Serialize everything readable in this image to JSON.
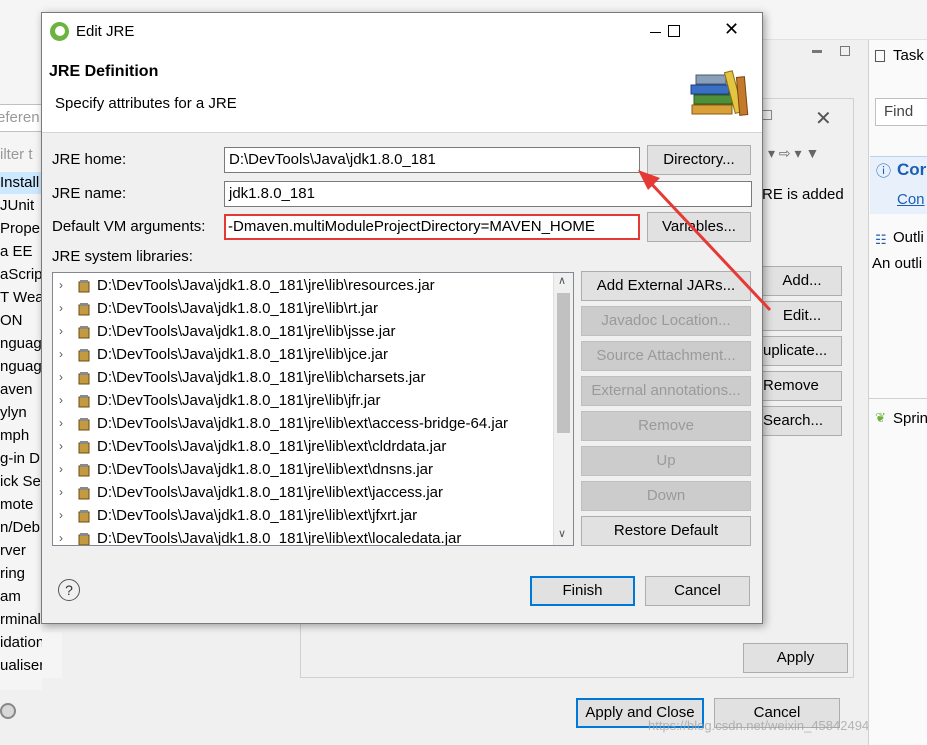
{
  "background": {
    "left_items": [
      "eferen",
      "ilter t",
      "Install",
      "JUnit",
      "Prope",
      "a EE",
      "aScrip",
      "T Wea",
      "ON",
      "nguag",
      "nguag",
      "aven",
      "ylyn",
      "mph",
      "g-in D",
      "ick Se",
      "mote",
      "n/Deb",
      "rver",
      "ring",
      "am",
      "rminal",
      "idation",
      "ualiser"
    ],
    "right_panel": {
      "task_label": "Task",
      "find_placeholder": "Find",
      "connect_title": "Cor",
      "connect_link": "Con",
      "outline_label": "Outli",
      "outline_text": "An outli",
      "spring_label": "Sprin"
    },
    "prefs_panel": {
      "jre_added_text": "RE is added",
      "add_button": "Add...",
      "edit_button": "Edit...",
      "duplicate_button": "uplicate...",
      "remove_button": "Remove",
      "search_button": "Search...",
      "apply_button": "Apply",
      "apply_close_button": "Apply and Close",
      "cancel_button": "Cancel"
    },
    "watermark": "https://blog.csdn.net/weixin_45842494"
  },
  "dialog": {
    "title": "Edit JRE",
    "header_title": "JRE Definition",
    "header_subtitle": "Specify attributes for a JRE",
    "jre_home_label": "JRE home:",
    "jre_home_value": "D:\\DevTools\\Java\\jdk1.8.0_181",
    "directory_button": "Directory...",
    "jre_name_label": "JRE name:",
    "jre_name_value": "jdk1.8.0_181",
    "vm_args_label": "Default VM arguments:",
    "vm_args_value": "-Dmaven.multiModuleProjectDirectory=MAVEN_HOME",
    "variables_button": "Variables...",
    "libraries_label": "JRE system libraries:",
    "libraries": [
      "D:\\DevTools\\Java\\jdk1.8.0_181\\jre\\lib\\resources.jar",
      "D:\\DevTools\\Java\\jdk1.8.0_181\\jre\\lib\\rt.jar",
      "D:\\DevTools\\Java\\jdk1.8.0_181\\jre\\lib\\jsse.jar",
      "D:\\DevTools\\Java\\jdk1.8.0_181\\jre\\lib\\jce.jar",
      "D:\\DevTools\\Java\\jdk1.8.0_181\\jre\\lib\\charsets.jar",
      "D:\\DevTools\\Java\\jdk1.8.0_181\\jre\\lib\\jfr.jar",
      "D:\\DevTools\\Java\\jdk1.8.0_181\\jre\\lib\\ext\\access-bridge-64.jar",
      "D:\\DevTools\\Java\\jdk1.8.0_181\\jre\\lib\\ext\\cldrdata.jar",
      "D:\\DevTools\\Java\\jdk1.8.0_181\\jre\\lib\\ext\\dnsns.jar",
      "D:\\DevTools\\Java\\jdk1.8.0_181\\jre\\lib\\ext\\jaccess.jar",
      "D:\\DevTools\\Java\\jdk1.8.0_181\\jre\\lib\\ext\\jfxrt.jar",
      "D:\\DevTools\\Java\\jdk1.8.0_181\\jre\\lib\\ext\\localedata.jar"
    ],
    "side_buttons": {
      "add_external_jars": "Add External JARs...",
      "javadoc_location": "Javadoc Location...",
      "source_attachment": "Source Attachment...",
      "external_annotations": "External annotations...",
      "remove": "Remove",
      "up": "Up",
      "down": "Down",
      "restore_default": "Restore Default"
    },
    "finish_button": "Finish",
    "cancel_button": "Cancel"
  },
  "colors": {
    "highlight_red": "#e53935",
    "default_button_blue": "#0078d7"
  }
}
